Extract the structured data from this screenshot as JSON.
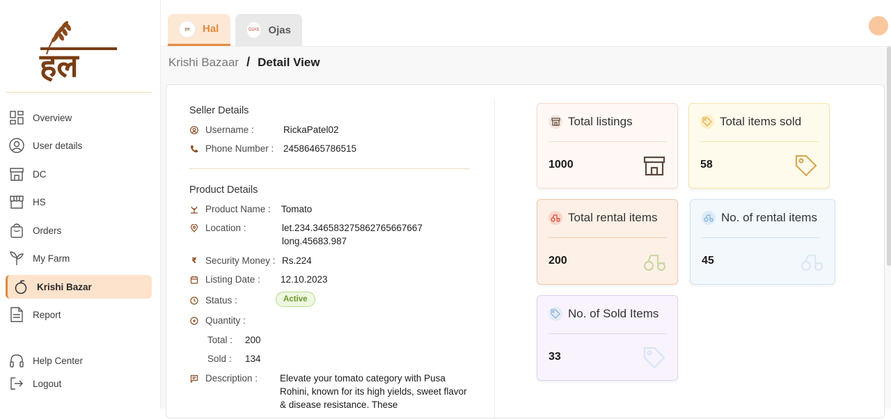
{
  "app": {
    "brand": "हल"
  },
  "sidebar": {
    "items": [
      {
        "label": "Overview",
        "icon": "grid-icon"
      },
      {
        "label": "User details",
        "icon": "user-circle-icon"
      },
      {
        "label": "DC",
        "icon": "store-icon"
      },
      {
        "label": "HS",
        "icon": "shop-icon"
      },
      {
        "label": "Orders",
        "icon": "bag-icon"
      },
      {
        "label": "My Farm",
        "icon": "sprout-icon"
      },
      {
        "label": "Krishi Bazar",
        "icon": "apple-icon",
        "active": true
      },
      {
        "label": "Report",
        "icon": "document-icon"
      }
    ],
    "help": "Help Center",
    "logout": "Logout"
  },
  "tabs": [
    {
      "label": "Hal",
      "active": true
    },
    {
      "label": "Ojas",
      "active": false
    }
  ],
  "breadcrumb": {
    "root": "Krishi Bazaar",
    "sep": "/",
    "current": "Detail View"
  },
  "seller": {
    "title": "Seller Details",
    "username_label": "Username :",
    "username": "RickaPatel02",
    "phone_label": "Phone Number :",
    "phone": "24586465786515"
  },
  "product": {
    "title": "Product Details",
    "name_label": "Product Name :",
    "name": "Tomato",
    "location_label": "Location :",
    "location_lat": "let.234.346583275862765667667",
    "location_long": "long.45683.987",
    "security_label": "Security Money :",
    "security": "Rs.224",
    "date_label": "Listing Date :",
    "date": "12.10.2023",
    "status_label": "Status :",
    "status": "Active",
    "quantity_label": "Quantity :",
    "total_label": "Total :",
    "total": "200",
    "sold_label": "Sold :",
    "sold": "134",
    "description_label": "Description :",
    "description": "Elevate your tomato category with Pusa Rohini, known for its high yields, sweet flavor & disease resistance. These"
  },
  "stats": [
    {
      "title": "Total listings",
      "value": "1000",
      "bg": "#fff8f5",
      "border": "#f3dccd",
      "accent": "#5a4a3a"
    },
    {
      "title": "Total items sold",
      "value": "58",
      "bg": "#fffbec",
      "border": "#f5e3a8",
      "accent": "#e6b24a"
    },
    {
      "title": "Total rental items",
      "value": "200",
      "bg": "#fdf0e6",
      "border": "#f2c9a8",
      "accent": "#d9463c"
    },
    {
      "title": "No. of rental items",
      "value": "45",
      "bg": "#f3f8fd",
      "border": "#cfe1f2",
      "accent": "#7fb2dc"
    },
    {
      "title": "No. of Sold Items",
      "value": "33",
      "bg": "#f8f3fd",
      "border": "#e0d2f0",
      "accent": "#8ab4dc"
    }
  ]
}
